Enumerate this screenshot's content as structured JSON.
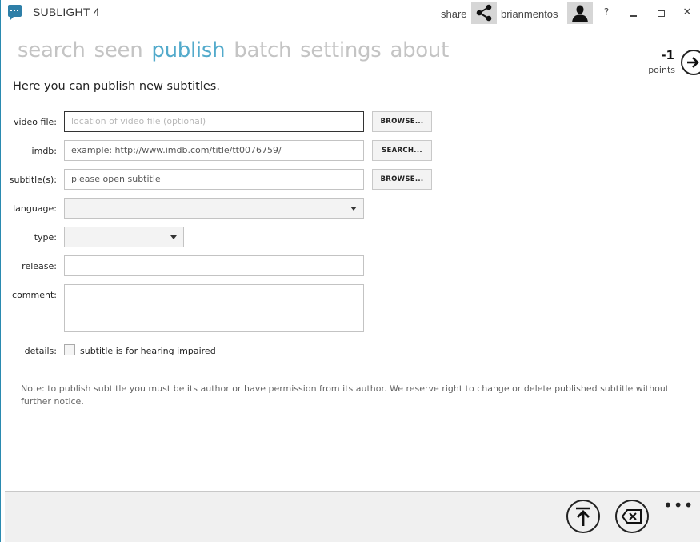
{
  "window": {
    "title": "SUBLIGHT 4",
    "share_label": "share",
    "username": "brianmentos",
    "help_label": "?",
    "close_label": "✕"
  },
  "nav": {
    "items": [
      {
        "label": "search"
      },
      {
        "label": "seen"
      },
      {
        "label": "publish",
        "active": true
      },
      {
        "label": "batch"
      },
      {
        "label": "settings"
      },
      {
        "label": "about"
      }
    ]
  },
  "points": {
    "value": "-1",
    "label": "points"
  },
  "intro": "Here you can publish new subtitles.",
  "form": {
    "video_file": {
      "label": "video file:",
      "placeholder": "location of video file (optional)",
      "button": "BROWSE..."
    },
    "imdb": {
      "label": "imdb:",
      "placeholder": "example: http://www.imdb.com/title/tt0076759/",
      "button": "SEARCH..."
    },
    "subtitles": {
      "label": "subtitle(s):",
      "value": "please open subtitle",
      "button": "BROWSE..."
    },
    "language": {
      "label": "language:",
      "value": ""
    },
    "type": {
      "label": "type:",
      "value": ""
    },
    "release": {
      "label": "release:",
      "value": ""
    },
    "comment": {
      "label": "comment:",
      "value": ""
    },
    "details": {
      "label": "details:",
      "checkbox_label": "subtitle is for hearing impaired",
      "checked": false
    }
  },
  "note": "Note: to publish subtitle you must be its author or have permission from its author. We reserve right to change or delete published subtitle without further notice.",
  "bottom": {
    "more_label": "•••"
  },
  "colors": {
    "accent": "#52aacb",
    "nav_inactive": "#c4c4c4",
    "icon_blue": "#2e7fa8"
  }
}
